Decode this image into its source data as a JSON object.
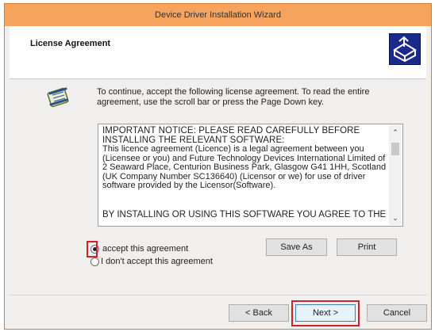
{
  "window": {
    "title": "Device Driver Installation Wizard"
  },
  "header": {
    "title": "License Agreement",
    "icon": "installer-box-icon"
  },
  "intro": {
    "icon": "license-scroll-icon",
    "text": "To continue, accept the following license agreement. To read the entire agreement, use the scroll bar or press the Page Down key."
  },
  "license": {
    "notice": "IMPORTANT NOTICE: PLEASE READ CAREFULLY BEFORE INSTALLING THE RELEVANT SOFTWARE:",
    "body": "This licence agreement (Licence) is a legal agreement between you (Licensee or you) and Future Technology Devices International Limited of 2 Seaward Place, Centurion Business Park, Glasgow G41 1HH, Scotland (UK Company Number SC136640) (Licensor or we) for use of driver software provided by the Licensor(Software).",
    "last": "BY INSTALLING OR USING THIS SOFTWARE YOU AGREE TO THE"
  },
  "options": {
    "accept_label": "accept this agreement",
    "decline_label": "I don't accept this agreement",
    "selected": "accept"
  },
  "buttons": {
    "save_as": "Save As",
    "print": "Print",
    "back": "< Back",
    "next": "Next >",
    "cancel": "Cancel"
  },
  "colors": {
    "titlebar": "#f5a35d",
    "highlight": "#d0202b"
  }
}
